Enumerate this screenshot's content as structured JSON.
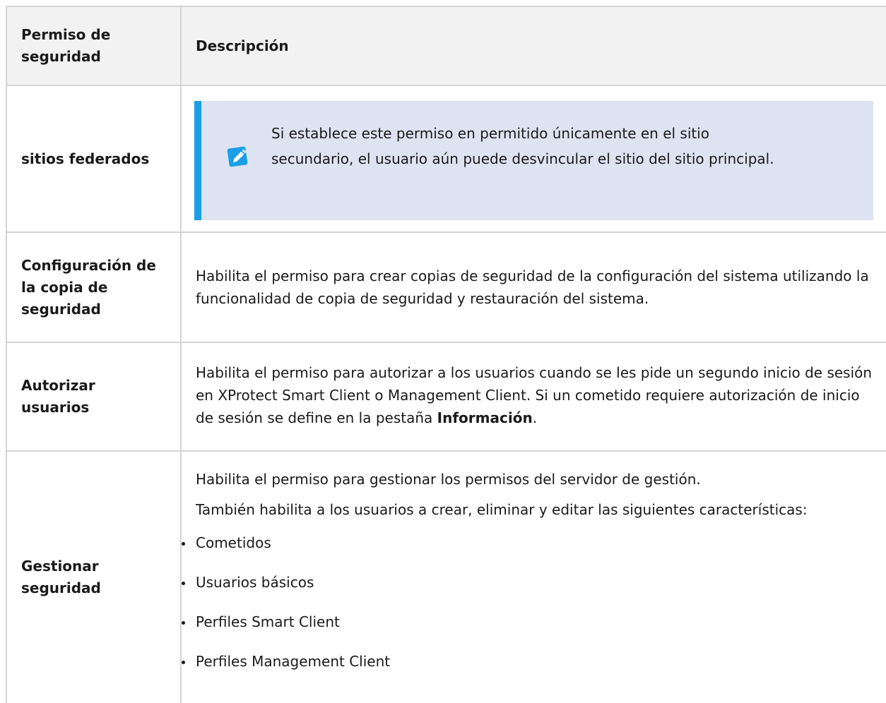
{
  "header": {
    "col1": "Permiso de seguridad",
    "col2": "Descripción"
  },
  "rows": {
    "federados": {
      "permission": "sitios federados",
      "note": "Si establece este permiso en permitido únicamente en el sitio secundario, el usuario aún puede desvincular el sitio del sitio principal."
    },
    "backup": {
      "permission": "Configuración de la copia de seguridad",
      "description": "Habilita el permiso para crear copias de seguridad de la configuración del sistema utilizando la funcionalidad de copia de seguridad y restauración del sistema."
    },
    "autorizar": {
      "permission": "Autorizar usuarios",
      "description_before": "Habilita el permiso para autorizar a los usuarios cuando se les pide un segundo inicio de sesión en XProtect Smart Client o Management Client. Si un cometido requiere autorización de inicio de sesión se define en la pestaña ",
      "description_bold": "Información",
      "description_after": "."
    },
    "gestionar": {
      "permission": "Gestionar seguridad",
      "description_1": "Habilita el permiso para gestionar los permisos del servidor de gestión.",
      "description_2": "También habilita a los usuarios a crear, eliminar y editar las siguientes características:",
      "items": [
        "Cometidos",
        "Usuarios básicos",
        "Perfiles Smart Client",
        "Perfiles Management Client"
      ]
    }
  },
  "colors": {
    "note_background": "#dde3f1",
    "note_accent": "#1a9ee6",
    "border": "#d4d4d4",
    "header_background": "#f2f2f2"
  },
  "icons": {
    "note": "pencil-note-icon"
  }
}
